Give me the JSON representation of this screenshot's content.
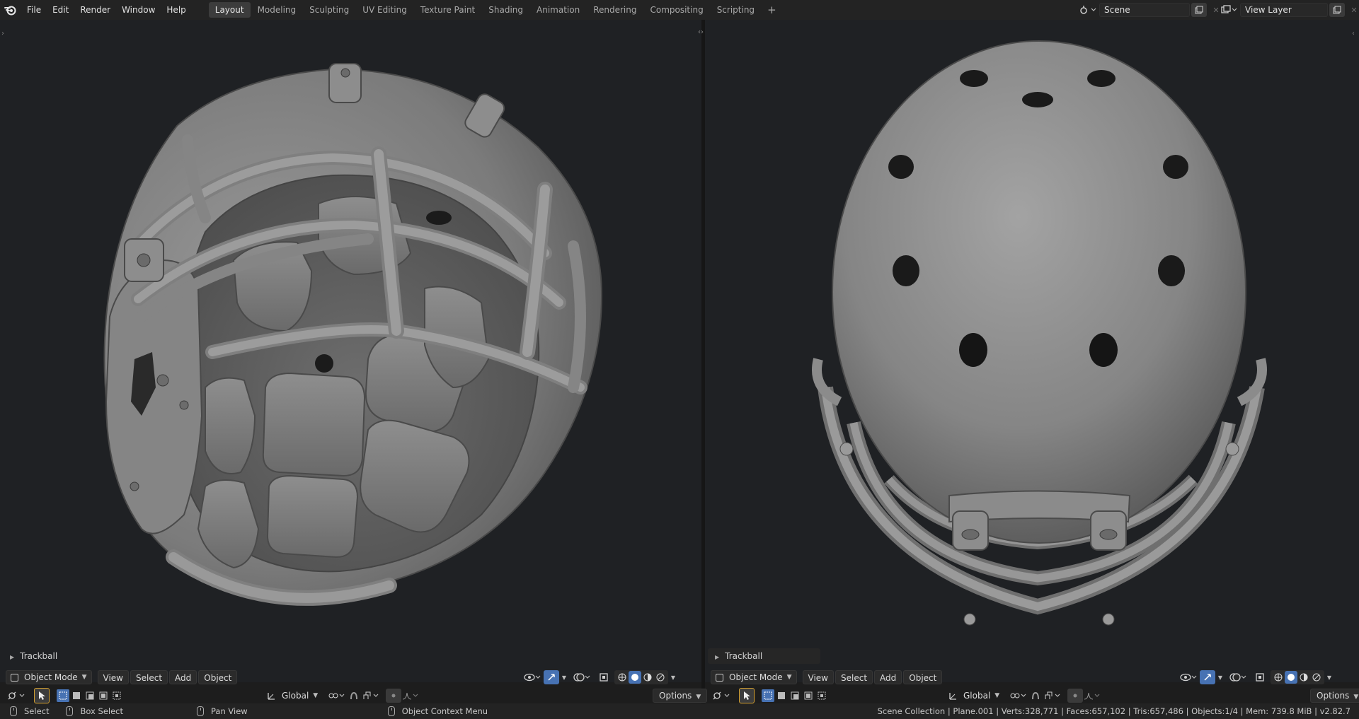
{
  "app": {
    "logo": "blender-logo"
  },
  "menu": [
    "File",
    "Edit",
    "Render",
    "Window",
    "Help"
  ],
  "workspaces": [
    "Layout",
    "Modeling",
    "Sculpting",
    "UV Editing",
    "Texture Paint",
    "Shading",
    "Animation",
    "Rendering",
    "Compositing",
    "Scripting"
  ],
  "active_workspace": "Layout",
  "add_workspace": "+",
  "scene": {
    "label": "Scene",
    "icon": "scene-icon"
  },
  "view_layer": {
    "label": "View Layer",
    "icon": "view-layer-icon"
  },
  "viewports": [
    {
      "id": "left",
      "operator_panel": "Trackball",
      "mode": "Object Mode",
      "header_menus": [
        "View",
        "Select",
        "Add",
        "Object"
      ],
      "orientation": "Global",
      "options": "Options",
      "content": "football-helmet-front-three-quarter"
    },
    {
      "id": "right",
      "operator_panel": "Trackball",
      "mode": "Object Mode",
      "header_menus": [
        "View",
        "Select",
        "Add",
        "Object"
      ],
      "orientation": "Global",
      "options": "Options",
      "content": "football-helmet-top-down"
    }
  ],
  "status": {
    "select": "Select",
    "box_select": "Box Select",
    "pan_view": "Pan View",
    "context_menu": "Object Context Menu",
    "stats": "Scene Collection | Plane.001 | Verts:328,771 | Faces:657,102 | Tris:657,486 | Objects:1/4 | Mem: 739.8 MiB | v2.82.7"
  },
  "colors": {
    "accent": "#4772b3",
    "viewport_bg": "#1f2124",
    "header_bg": "#232323",
    "model_gray": "#8a8a8a"
  }
}
